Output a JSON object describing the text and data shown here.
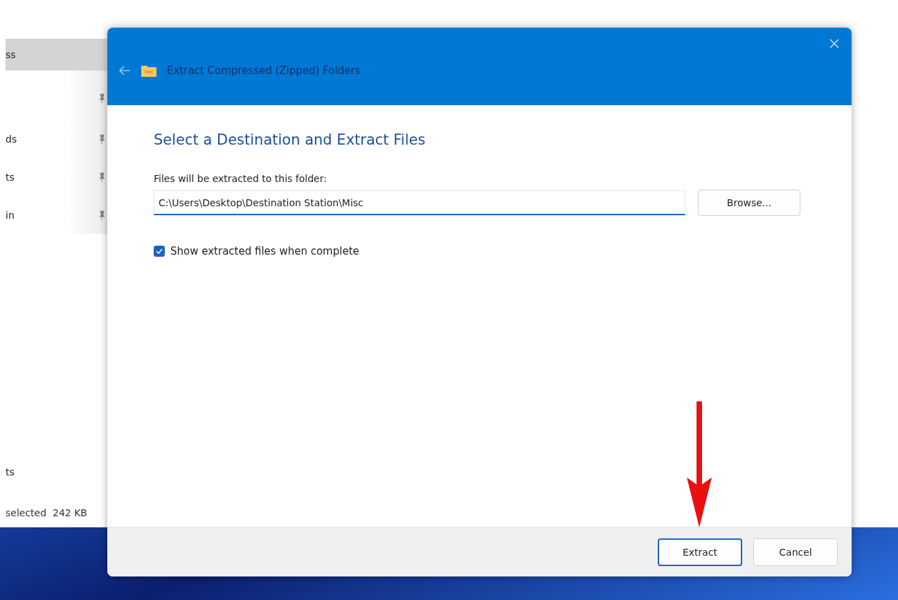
{
  "explorer": {
    "nav_items": [
      {
        "label": "ss",
        "selected": true,
        "pinned": false
      },
      {
        "selected": false,
        "pinned": true
      },
      {
        "label": "ds",
        "selected": false,
        "pinned": true
      },
      {
        "label": "ts",
        "selected": false,
        "pinned": true
      },
      {
        "label": "in",
        "selected": false,
        "pinned": true
      }
    ],
    "lower_item": "ts",
    "status_bar": "selected  242 KB"
  },
  "dialog": {
    "title": "Extract Compressed (Zipped) Folders",
    "heading": "Select a Destination and Extract Files",
    "field_label": "Files will be extracted to this folder:",
    "path": "C:\\Users\\Desktop\\Destination Station\\Misc",
    "browse": "Browse...",
    "show_files": {
      "label": "Show extracted files when complete",
      "checked": true
    },
    "buttons": [
      {
        "label": "Extract",
        "default": true
      },
      {
        "label": "Cancel",
        "default": false
      }
    ]
  }
}
